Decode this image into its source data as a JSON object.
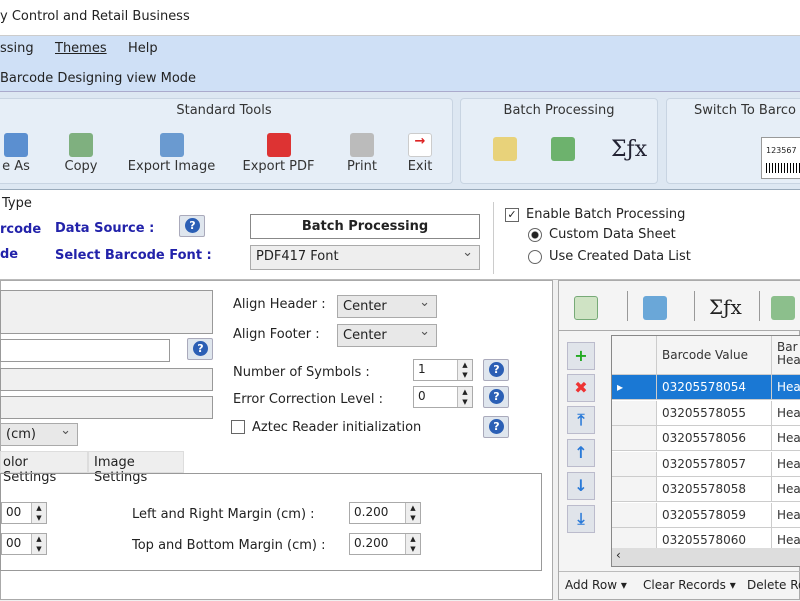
{
  "window": {
    "title": "y Control and Retail Business"
  },
  "menu": [
    "ssing",
    "Themes",
    "Help"
  ],
  "mode": "Barcode Designing view Mode",
  "toolbar": {
    "standard": {
      "title": "Standard Tools",
      "buttons": [
        "e As",
        "Copy",
        "Export Image",
        "Export PDF",
        "Print",
        "Exit"
      ]
    },
    "batch": {
      "title": "Batch Processing",
      "icons": [
        "edit-icon",
        "excel-import-icon",
        "sigma-fx-icon"
      ],
      "sigma": "Σƒx"
    },
    "switch": {
      "title": "Switch To Barco",
      "preview_text": "123567"
    }
  },
  "type_panel": {
    "group_label": "Type",
    "left1": "rcode",
    "left2": "de",
    "data_source_label": "Data Source :",
    "font_label": "Select Barcode Font :",
    "batch_button": "Batch Processing",
    "font_value": "PDF417 Font",
    "enable_batch": {
      "label": "Enable Batch Processing",
      "checked": true
    },
    "radios": [
      {
        "label": "Custom Data Sheet",
        "selected": true
      },
      {
        "label": "Use Created Data List",
        "selected": false
      }
    ]
  },
  "settings": {
    "unit_value": "(cm)",
    "align_header_label": "Align Header :",
    "align_header": "Center",
    "align_footer_label": "Align Footer :",
    "align_footer": "Center",
    "symbols_label": "Number of Symbols :",
    "symbols": "1",
    "ecl_label": "Error Correction Level :",
    "ecl": "0",
    "aztec": {
      "label": "Aztec Reader initialization",
      "checked": false
    },
    "tabs": [
      "olor Settings",
      "Image Settings"
    ],
    "left_val1": "00",
    "left_val2": "00",
    "lr_margin_label": "Left  and Right Margin (cm) :",
    "lr_margin": "0.200",
    "tb_margin_label": "Top and Bottom Margin (cm) :",
    "tb_margin": "0.200"
  },
  "grid": {
    "sigma": "Σƒx",
    "columns": [
      "Barcode Value",
      "Bar Hea"
    ],
    "rows": [
      [
        "03205578054",
        "Hea"
      ],
      [
        "03205578055",
        "Hea"
      ],
      [
        "03205578056",
        "Hea"
      ],
      [
        "03205578057",
        "Hea"
      ],
      [
        "03205578058",
        "Hea"
      ],
      [
        "03205578059",
        "Hea"
      ],
      [
        "03205578060",
        "Hea"
      ]
    ],
    "selected_row": 0,
    "footer": [
      "Add Row ▾",
      "Clear Records ▾",
      "Delete Ro"
    ]
  },
  "colors": {
    "menu_bg": "#cfe0f6",
    "label_blue": "#2222aa",
    "selection": "#1a78d4"
  }
}
